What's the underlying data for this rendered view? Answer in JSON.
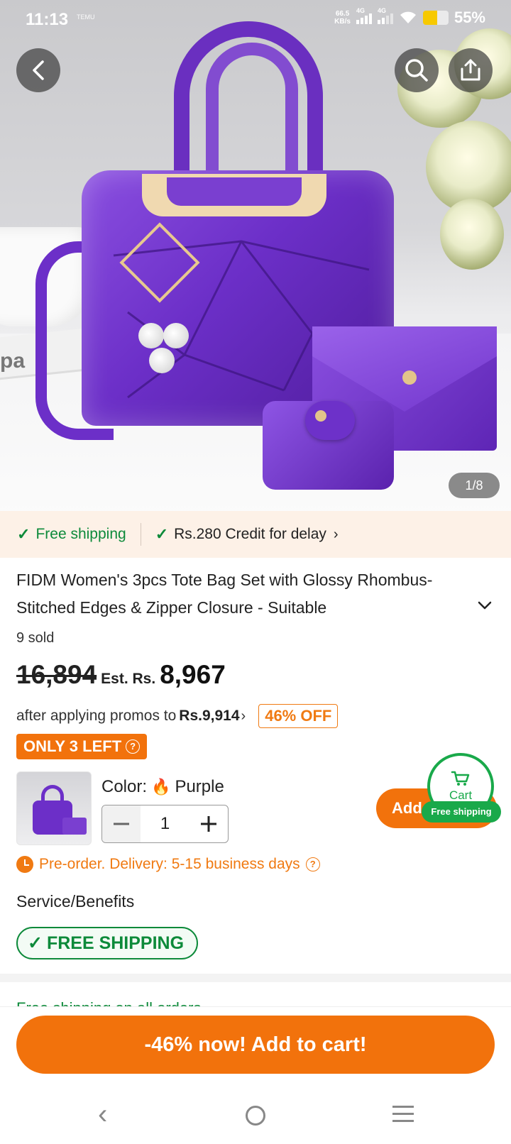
{
  "status_bar": {
    "time": "11:13",
    "brand": "TEMU",
    "net_speed_value": "66.5",
    "net_speed_unit": "KB/s",
    "network_1": "4G",
    "network_2": "4G",
    "battery": "55%"
  },
  "hero": {
    "image_counter": "1/8",
    "book_text": "pa"
  },
  "shipping_strip": {
    "free_shipping": "Free shipping",
    "credit": "Rs.280 Credit for delay"
  },
  "product": {
    "title": "FIDM Women's 3pcs Tote Bag Set with Glossy Rhombus-Stitched Edges & Zipper Closure - Suitable",
    "sold": "9 sold",
    "price_old": "16,894",
    "price_est_label": "Est. Rs.",
    "price_new": "8,967",
    "promo_text": "after applying promos to",
    "promo_price": "Rs.9,914",
    "discount": "46% OFF",
    "stock_badge": "ONLY 3 LEFT"
  },
  "variant": {
    "color_label": "Color:",
    "color_value": "Purple",
    "quantity": "1",
    "add_button": "Add",
    "cart_label": "Cart",
    "cart_badge": "Free shipping"
  },
  "delivery": {
    "text": "Pre-order. Delivery: 5-15 business days"
  },
  "service": {
    "title": "Service/Benefits",
    "badge": "FREE SHIPPING",
    "peek_text": "Free shipping on all orders"
  },
  "cta": {
    "label": "-46% now! Add to cart!"
  },
  "colors": {
    "accent_orange": "#f2720c",
    "success_green": "#0d8a3a",
    "strip_bg": "#fdf1e7"
  },
  "icons": [
    "back-arrow-icon",
    "search-icon",
    "share-icon",
    "check-icon",
    "chevron-right-icon",
    "chevron-down-icon",
    "help-icon",
    "flame-icon",
    "minus-icon",
    "plus-icon",
    "cart-icon",
    "clock-icon"
  ]
}
